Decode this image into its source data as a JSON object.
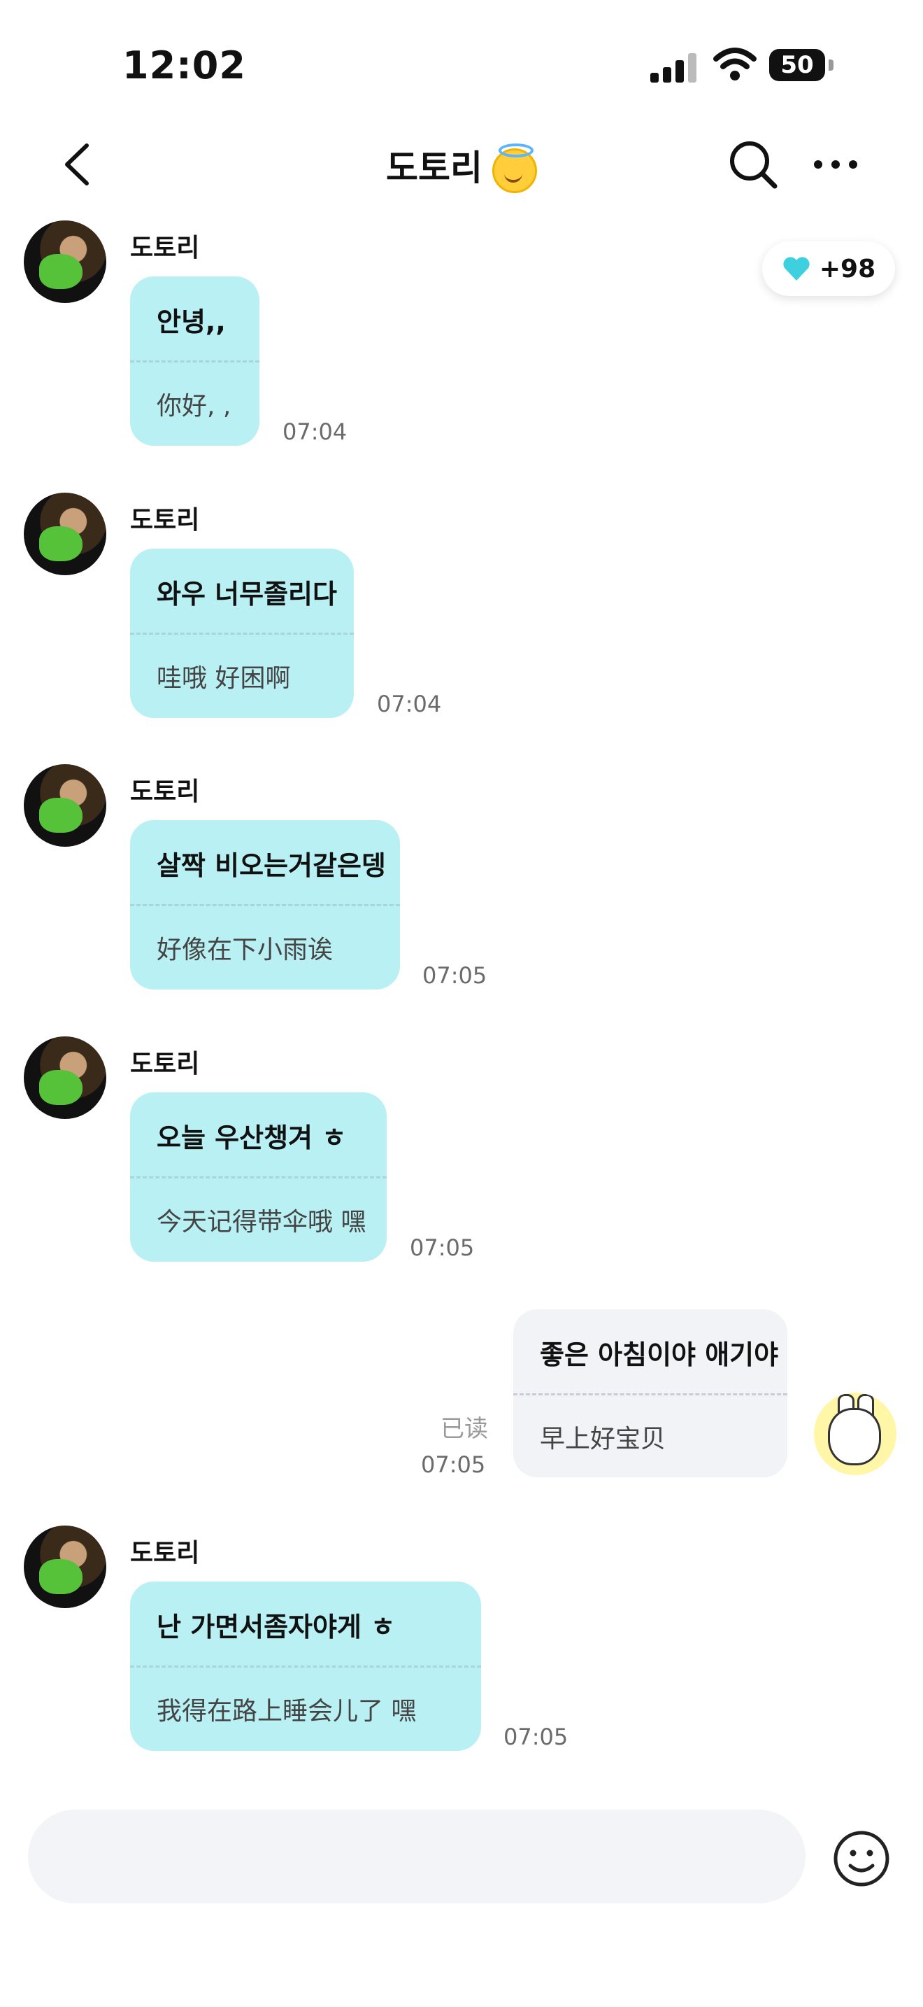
{
  "status_bar": {
    "time": "12:02",
    "battery": "50"
  },
  "header": {
    "title": "도토리"
  },
  "heart_badge": {
    "count": "+98",
    "color": "#3fd0e0"
  },
  "messages": [
    {
      "sender": "도토리",
      "text_ko": "안녕,,",
      "text_zh": "你好, ,",
      "time": "07:04"
    },
    {
      "sender": "도토리",
      "text_ko": "와우 너무졸리다",
      "text_zh": "哇哦 好困啊",
      "time": "07:04"
    },
    {
      "sender": "도토리",
      "text_ko": "살짝 비오는거같은뎅",
      "text_zh": "好像在下小雨诶",
      "time": "07:05"
    },
    {
      "sender": "도토리",
      "text_ko": "오늘 우산챙겨 ㅎ",
      "text_zh": "今天记得带伞哦 嘿",
      "time": "07:05"
    },
    {
      "sender": "me",
      "text_ko": "좋은 아침이야 애기야",
      "text_zh": "早上好宝贝",
      "time": "07:05",
      "read": "已读"
    },
    {
      "sender": "도토리",
      "text_ko": "난 가면서좀자야게 ㅎ",
      "text_zh": "我得在路上睡会儿了 嘿",
      "time": "07:05"
    }
  ],
  "input": {
    "value": "",
    "placeholder": ""
  },
  "colors": {
    "incoming_bubble": "#b9f0f3",
    "outgoing_bubble": "#f2f3f6"
  }
}
